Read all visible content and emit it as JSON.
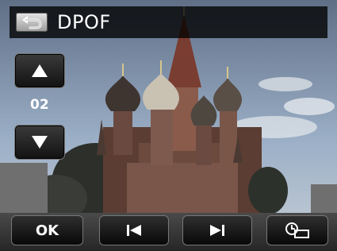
{
  "header": {
    "title": "DPOF",
    "back_icon": "return-arrow-icon"
  },
  "side_nav": {
    "up_icon": "triangle-up-icon",
    "down_icon": "triangle-down-icon",
    "count": "02"
  },
  "toolbar": {
    "ok_label": "OK",
    "prev_icon": "skip-previous-icon",
    "next_icon": "skip-next-icon",
    "timer_icon": "date-stamp-icon"
  },
  "colors": {
    "sky": "#8fa6c0",
    "button_dark": "#1a1a1a",
    "text": "#ffffff"
  }
}
